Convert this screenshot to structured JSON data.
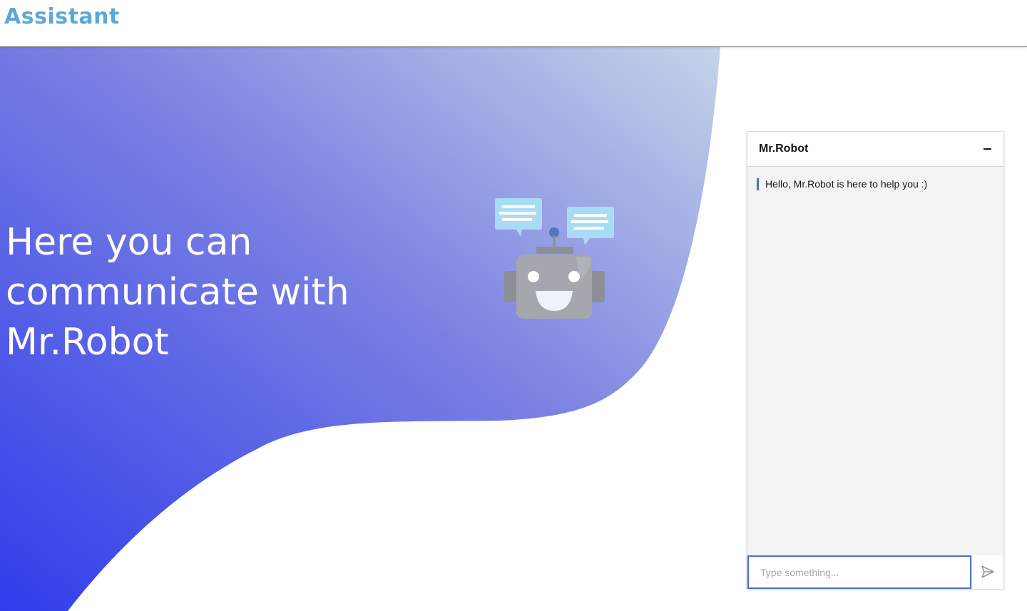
{
  "header": {
    "brand": "Assistant"
  },
  "hero": {
    "title": "Here you can communicate with Mr.Robot",
    "gradient_colors": [
      "#3a46e6",
      "#7b80e0",
      "#b8c7e6"
    ]
  },
  "robot": {
    "icon": "robot-icon",
    "bubble_color": "#9fd3ef",
    "head_color": "#a4a7ad"
  },
  "chat": {
    "title": "Mr.Robot",
    "minimize_icon": "minus-icon",
    "messages": [
      {
        "text": "Hello, Mr.Robot is here to help you :)"
      }
    ],
    "input": {
      "value": "",
      "placeholder": "Type something..."
    },
    "send_icon": "send-icon",
    "accent_color": "#4a6fd0"
  }
}
